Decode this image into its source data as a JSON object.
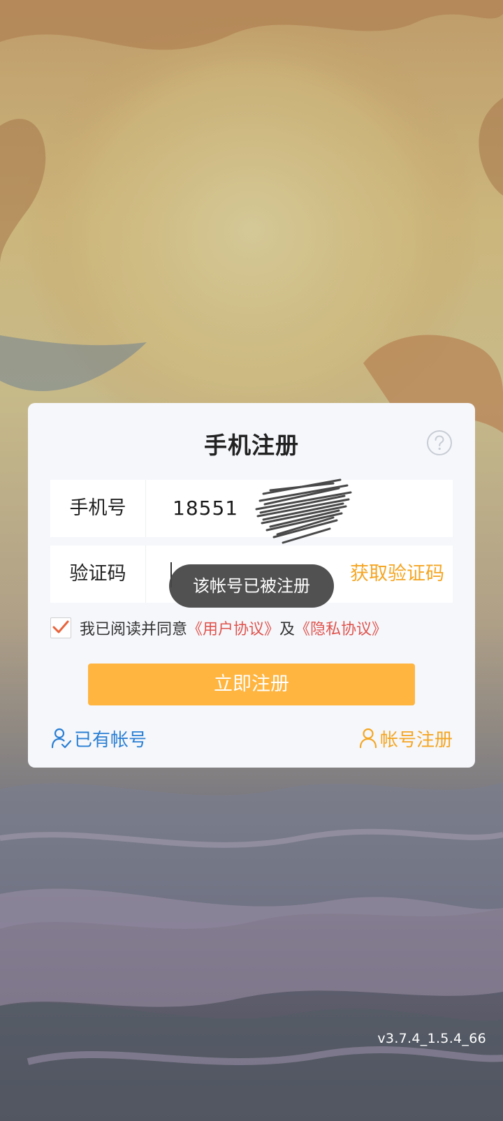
{
  "dialog": {
    "title": "手机注册",
    "help_icon": "help-question-icon",
    "phone_label": "手机号",
    "phone_value": "18551",
    "code_label": "验证码",
    "code_value": "",
    "get_code_label": "获取验证码",
    "agreement": {
      "checked": true,
      "prefix": "我已阅读并同意",
      "user_agreement": "《用户协议》",
      "and": "及",
      "privacy_agreement": "《隐私协议》"
    },
    "register_button": "立即注册",
    "have_account_link": "已有帐号",
    "account_register_link": "帐号注册"
  },
  "toast": {
    "message": "该帐号已被注册"
  },
  "version": "v3.7.4_1.5.4_66",
  "colors": {
    "accent_orange": "#ffb53f",
    "link_orange": "#f5a623",
    "link_blue": "#2a7fd4",
    "agreement_red": "#e0534d",
    "checkbox_mark": "#e8643c"
  }
}
